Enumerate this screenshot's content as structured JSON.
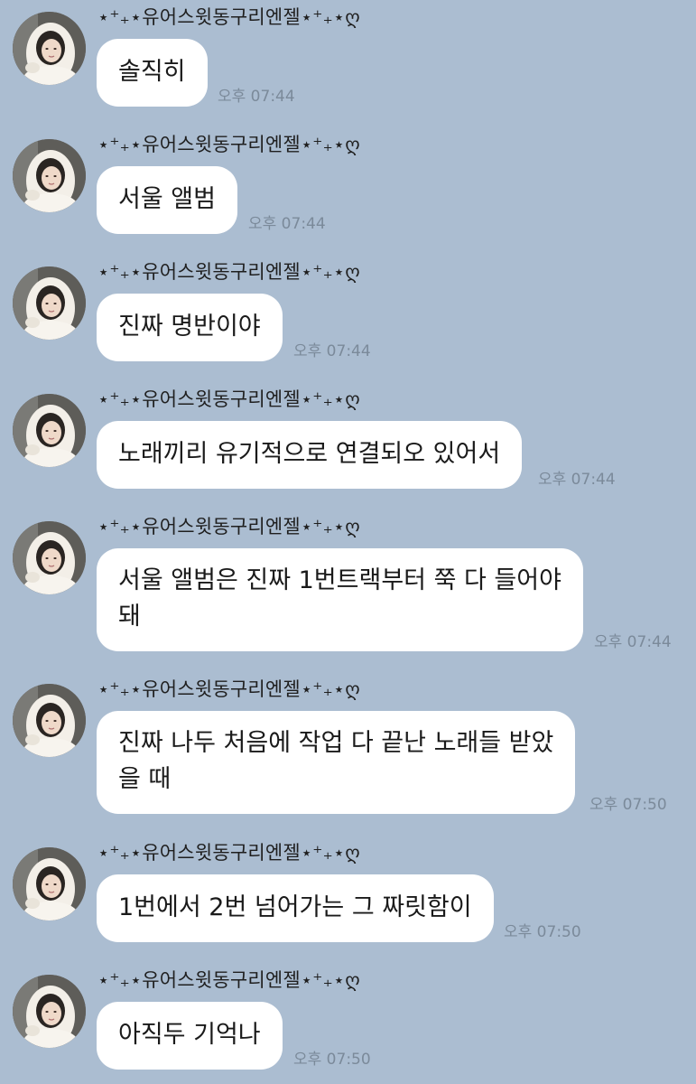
{
  "chat": {
    "sender_name": "⋆⁺₊⋆유어스윗동구리엔젤⋆⁺₊⋆ღ",
    "messages": [
      {
        "text": "솔직히",
        "time": "오후 07:44"
      },
      {
        "text": "서울 앨범",
        "time": "오후 07:44"
      },
      {
        "text": "진짜 명반이야",
        "time": "오후 07:44"
      },
      {
        "text": "노래끼리 유기적으로 연결되오 있어서",
        "time": "오후 07:44"
      },
      {
        "text_line1": "서울 앨범은 진짜 1번트랙부터 쭉 다 들어야",
        "text_line2": "돼",
        "time": "오후 07:44"
      },
      {
        "text_line1": "진짜 나두 처음에 작업 다 끝난 노래들 받았",
        "text_line2": "을 때",
        "time": "오후 07:50"
      },
      {
        "text": "1번에서 2번 넘어가는 그 짜릿함이",
        "time": "오후 07:50"
      },
      {
        "text": "아직두 기억나",
        "time": "오후 07:50"
      }
    ]
  },
  "colors": {
    "background": "#abbdd1",
    "bubble": "#ffffff",
    "time": "#7b8a9a"
  }
}
